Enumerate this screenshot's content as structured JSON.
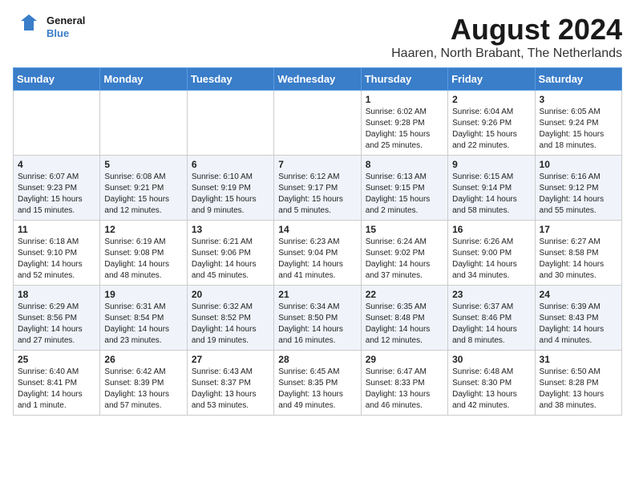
{
  "header": {
    "logo_general": "General",
    "logo_blue": "Blue",
    "month_title": "August 2024",
    "location": "Haaren, North Brabant, The Netherlands"
  },
  "days_of_week": [
    "Sunday",
    "Monday",
    "Tuesday",
    "Wednesday",
    "Thursday",
    "Friday",
    "Saturday"
  ],
  "weeks": [
    [
      {
        "day": "",
        "text": ""
      },
      {
        "day": "",
        "text": ""
      },
      {
        "day": "",
        "text": ""
      },
      {
        "day": "",
        "text": ""
      },
      {
        "day": "1",
        "text": "Sunrise: 6:02 AM\nSunset: 9:28 PM\nDaylight: 15 hours\nand 25 minutes."
      },
      {
        "day": "2",
        "text": "Sunrise: 6:04 AM\nSunset: 9:26 PM\nDaylight: 15 hours\nand 22 minutes."
      },
      {
        "day": "3",
        "text": "Sunrise: 6:05 AM\nSunset: 9:24 PM\nDaylight: 15 hours\nand 18 minutes."
      }
    ],
    [
      {
        "day": "4",
        "text": "Sunrise: 6:07 AM\nSunset: 9:23 PM\nDaylight: 15 hours\nand 15 minutes."
      },
      {
        "day": "5",
        "text": "Sunrise: 6:08 AM\nSunset: 9:21 PM\nDaylight: 15 hours\nand 12 minutes."
      },
      {
        "day": "6",
        "text": "Sunrise: 6:10 AM\nSunset: 9:19 PM\nDaylight: 15 hours\nand 9 minutes."
      },
      {
        "day": "7",
        "text": "Sunrise: 6:12 AM\nSunset: 9:17 PM\nDaylight: 15 hours\nand 5 minutes."
      },
      {
        "day": "8",
        "text": "Sunrise: 6:13 AM\nSunset: 9:15 PM\nDaylight: 15 hours\nand 2 minutes."
      },
      {
        "day": "9",
        "text": "Sunrise: 6:15 AM\nSunset: 9:14 PM\nDaylight: 14 hours\nand 58 minutes."
      },
      {
        "day": "10",
        "text": "Sunrise: 6:16 AM\nSunset: 9:12 PM\nDaylight: 14 hours\nand 55 minutes."
      }
    ],
    [
      {
        "day": "11",
        "text": "Sunrise: 6:18 AM\nSunset: 9:10 PM\nDaylight: 14 hours\nand 52 minutes."
      },
      {
        "day": "12",
        "text": "Sunrise: 6:19 AM\nSunset: 9:08 PM\nDaylight: 14 hours\nand 48 minutes."
      },
      {
        "day": "13",
        "text": "Sunrise: 6:21 AM\nSunset: 9:06 PM\nDaylight: 14 hours\nand 45 minutes."
      },
      {
        "day": "14",
        "text": "Sunrise: 6:23 AM\nSunset: 9:04 PM\nDaylight: 14 hours\nand 41 minutes."
      },
      {
        "day": "15",
        "text": "Sunrise: 6:24 AM\nSunset: 9:02 PM\nDaylight: 14 hours\nand 37 minutes."
      },
      {
        "day": "16",
        "text": "Sunrise: 6:26 AM\nSunset: 9:00 PM\nDaylight: 14 hours\nand 34 minutes."
      },
      {
        "day": "17",
        "text": "Sunrise: 6:27 AM\nSunset: 8:58 PM\nDaylight: 14 hours\nand 30 minutes."
      }
    ],
    [
      {
        "day": "18",
        "text": "Sunrise: 6:29 AM\nSunset: 8:56 PM\nDaylight: 14 hours\nand 27 minutes."
      },
      {
        "day": "19",
        "text": "Sunrise: 6:31 AM\nSunset: 8:54 PM\nDaylight: 14 hours\nand 23 minutes."
      },
      {
        "day": "20",
        "text": "Sunrise: 6:32 AM\nSunset: 8:52 PM\nDaylight: 14 hours\nand 19 minutes."
      },
      {
        "day": "21",
        "text": "Sunrise: 6:34 AM\nSunset: 8:50 PM\nDaylight: 14 hours\nand 16 minutes."
      },
      {
        "day": "22",
        "text": "Sunrise: 6:35 AM\nSunset: 8:48 PM\nDaylight: 14 hours\nand 12 minutes."
      },
      {
        "day": "23",
        "text": "Sunrise: 6:37 AM\nSunset: 8:46 PM\nDaylight: 14 hours\nand 8 minutes."
      },
      {
        "day": "24",
        "text": "Sunrise: 6:39 AM\nSunset: 8:43 PM\nDaylight: 14 hours\nand 4 minutes."
      }
    ],
    [
      {
        "day": "25",
        "text": "Sunrise: 6:40 AM\nSunset: 8:41 PM\nDaylight: 14 hours\nand 1 minute."
      },
      {
        "day": "26",
        "text": "Sunrise: 6:42 AM\nSunset: 8:39 PM\nDaylight: 13 hours\nand 57 minutes."
      },
      {
        "day": "27",
        "text": "Sunrise: 6:43 AM\nSunset: 8:37 PM\nDaylight: 13 hours\nand 53 minutes."
      },
      {
        "day": "28",
        "text": "Sunrise: 6:45 AM\nSunset: 8:35 PM\nDaylight: 13 hours\nand 49 minutes."
      },
      {
        "day": "29",
        "text": "Sunrise: 6:47 AM\nSunset: 8:33 PM\nDaylight: 13 hours\nand 46 minutes."
      },
      {
        "day": "30",
        "text": "Sunrise: 6:48 AM\nSunset: 8:30 PM\nDaylight: 13 hours\nand 42 minutes."
      },
      {
        "day": "31",
        "text": "Sunrise: 6:50 AM\nSunset: 8:28 PM\nDaylight: 13 hours\nand 38 minutes."
      }
    ]
  ]
}
